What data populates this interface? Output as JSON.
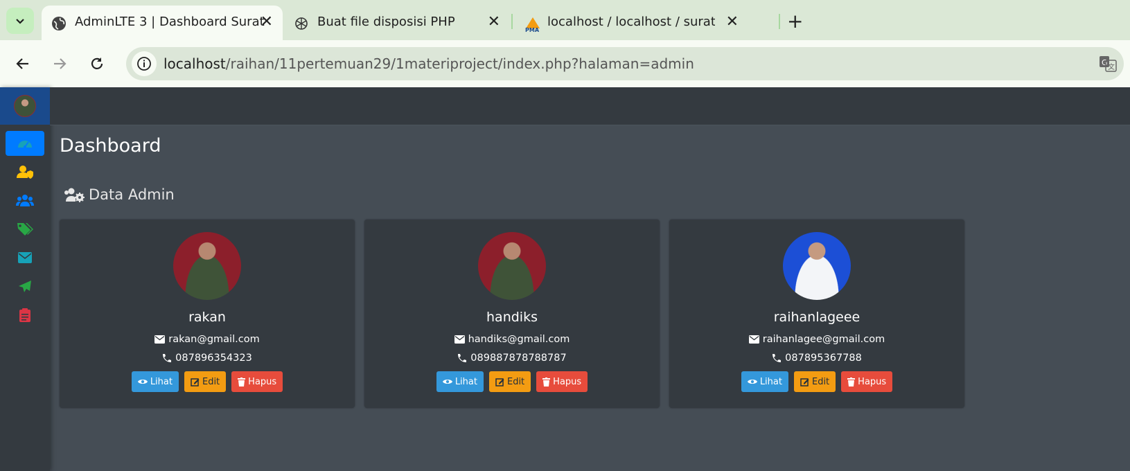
{
  "browser": {
    "tabs": [
      {
        "label": "AdminLTE 3 | Dashboard Surat",
        "icon": "globe-icon",
        "active": true
      },
      {
        "label": "Buat file disposisi PHP",
        "icon": "openai-icon",
        "active": false
      },
      {
        "label": "localhost / localhost / surat_ma",
        "icon": "phpmyadmin-icon",
        "active": false
      }
    ],
    "url_host": "localhost",
    "url_path": "/raihan/11pertemuan29/1materiproject/index.php?halaman=admin"
  },
  "sidebar": {
    "items": [
      {
        "name": "dashboard",
        "icon": "tachometer-icon",
        "color": "#17a2b8",
        "active": true
      },
      {
        "name": "admin",
        "icon": "user-shield-icon",
        "color": "#ffc107",
        "active": false
      },
      {
        "name": "users",
        "icon": "users-icon",
        "color": "#007bff",
        "active": false
      },
      {
        "name": "tags",
        "icon": "tags-icon",
        "color": "#28a745",
        "active": false
      },
      {
        "name": "mail",
        "icon": "envelope-icon",
        "color": "#17a2b8",
        "active": false
      },
      {
        "name": "send",
        "icon": "paper-plane-icon",
        "color": "#28a745",
        "active": false
      },
      {
        "name": "clipboard",
        "icon": "clipboard-list-icon",
        "color": "#dc3545",
        "active": false
      }
    ]
  },
  "page": {
    "title": "Dashboard",
    "section_title": "Data Admin"
  },
  "admins": [
    {
      "name": "rakan",
      "email": "rakan@gmail.com",
      "phone": "087896354323",
      "photo_bg": "#8c1f2b"
    },
    {
      "name": "handiks",
      "email": "handiks@gmail.com",
      "phone": "089887878788787",
      "photo_bg": "#8c1f2b"
    },
    {
      "name": "raihanlageee",
      "email": "raihanlagee@gmail.com",
      "phone": "087895367788",
      "photo_bg": "#1c4fd6"
    }
  ],
  "buttons": {
    "view": "Lihat",
    "edit": "Edit",
    "delete": "Hapus"
  }
}
